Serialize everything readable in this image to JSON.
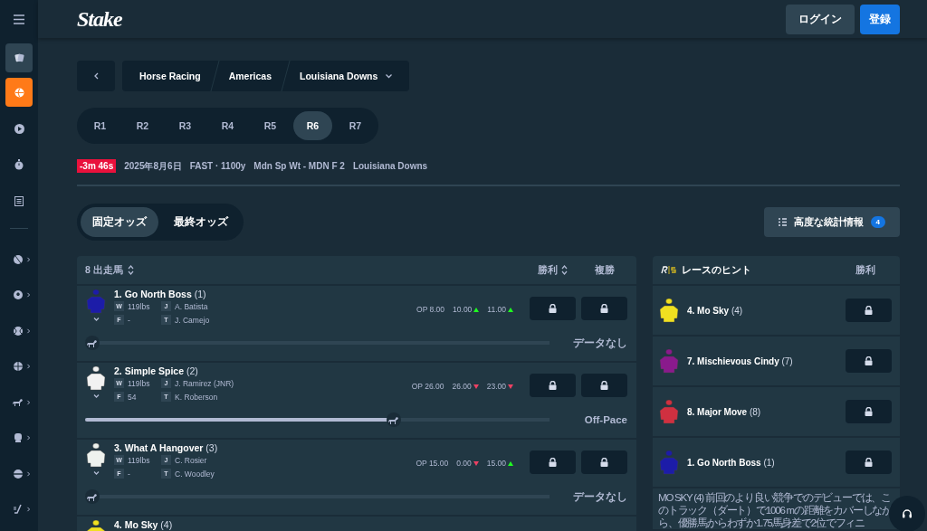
{
  "header": {
    "logo": "Stake",
    "buttons": [
      {
        "label": "ログイン",
        "kind": "secondary"
      },
      {
        "label": "登録",
        "kind": "primary"
      }
    ]
  },
  "sidebar": {
    "tiles": [
      {
        "selected": false
      },
      {
        "selected": true
      }
    ]
  },
  "breadcrumb": [
    "Horse Racing",
    "Americas",
    "Louisiana Downs"
  ],
  "race_tabs": [
    {
      "label": "R1",
      "selected": false
    },
    {
      "label": "R2",
      "selected": false
    },
    {
      "label": "R3",
      "selected": false
    },
    {
      "label": "R4",
      "selected": false
    },
    {
      "label": "R5",
      "selected": false
    },
    {
      "label": "R6",
      "selected": true
    },
    {
      "label": "R7",
      "selected": false
    }
  ],
  "race_info": {
    "countdown": "-3m 46s",
    "details": [
      "2025年8月6日",
      "FAST · 1100y",
      "Mdn Sp Wt - MDN F 2",
      "Louisiana Downs"
    ]
  },
  "odds_toggle": [
    {
      "label": "固定オッズ",
      "selected": true
    },
    {
      "label": "最終オッズ",
      "selected": false
    }
  ],
  "stats_button": {
    "label": "高度な統計情報",
    "badge": "4"
  },
  "runners_table": {
    "title": "8 出走馬",
    "columns": [
      "勝利",
      "複勝"
    ],
    "rows": [
      {
        "name": "**1. Go North Boss** (1)",
        "color": "#1c1ca8",
        "details": [
          {
            "tag": "W",
            "value": "119lbs"
          },
          {
            "tag": "J",
            "value": "A. Batista"
          },
          {
            "tag": "F",
            "value": "-"
          },
          {
            "tag": "T",
            "value": "J. Camejo"
          }
        ],
        "odds": [
          {
            "value": "OP 8.00"
          },
          {
            "value": "10.00",
            "up": true
          },
          {
            "value": "11.00",
            "up": true
          }
        ],
        "level": 0,
        "pace": "データなし"
      },
      {
        "name": "**2. Simple Spice** (2)",
        "color": "#f2f2f2",
        "details": [
          {
            "tag": "W",
            "value": "119lbs"
          },
          {
            "tag": "J",
            "value": "J. Ramirez (JNR)"
          },
          {
            "tag": "F",
            "value": "54"
          },
          {
            "tag": "T",
            "value": "K. Roberson"
          }
        ],
        "odds": [
          {
            "value": "OP 26.00"
          },
          {
            "value": "26.00",
            "up": false
          },
          {
            "value": "23.00",
            "up": false
          }
        ],
        "level": 0.67,
        "pace": "Off-Pace"
      },
      {
        "name": "**3. What A Hangover** (3)",
        "color": "#eef2ee",
        "details": [
          {
            "tag": "W",
            "value": "119lbs"
          },
          {
            "tag": "J",
            "value": "C. Rosier"
          },
          {
            "tag": "F",
            "value": "-"
          },
          {
            "tag": "T",
            "value": "C. Woodley"
          }
        ],
        "odds": [
          {
            "value": "OP 15.00"
          },
          {
            "value": "0.00",
            "up": false
          },
          {
            "value": "15.00",
            "up": true
          }
        ],
        "level": 0,
        "pace": "データなし"
      },
      {
        "name": "**4. Mo Sky** (4)",
        "color": "#f0e020"
      }
    ]
  },
  "tips_panel": {
    "title": "レースのヒント",
    "column": "勝利",
    "tips": [
      {
        "name": "**4. Mo Sky** (4)",
        "color": "#f0e020"
      },
      {
        "name": "**7. Mischievous Cindy** (7)",
        "color": "#8a1a8c"
      },
      {
        "name": "**8. Major Move** (8)",
        "color": "#d03040"
      },
      {
        "name": "**1. Go North Boss** (1)",
        "color": "#1c1ca8"
      }
    ],
    "text": "MO SKY (4) 前回のより良い競争でのデビューでは、このトラック（ダート）で1006 mの距離をカバーしながら、優勝馬からわずか1.75馬身差で2位でフィニ"
  }
}
